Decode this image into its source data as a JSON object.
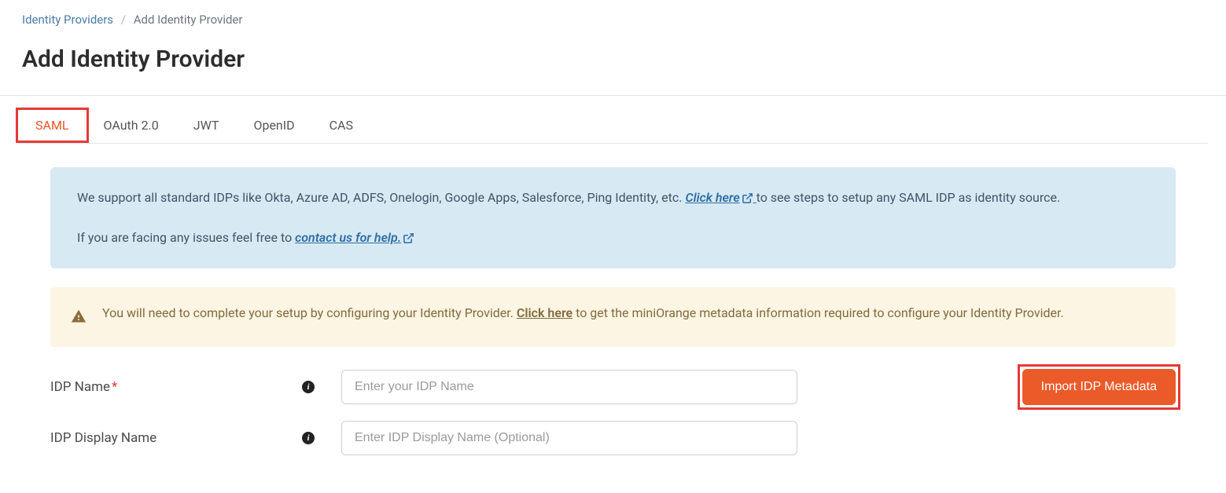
{
  "breadcrumb": {
    "parent": "Identity Providers",
    "current": "Add Identity Provider"
  },
  "page_title": "Add Identity Provider",
  "tabs": {
    "saml": "SAML",
    "oauth": "OAuth 2.0",
    "jwt": "JWT",
    "openid": "OpenID",
    "cas": "CAS"
  },
  "info_alert": {
    "text1": "We support all standard IDPs like Okta, Azure AD, ADFS, Onelogin, Google Apps, Salesforce, Ping Identity, etc. ",
    "click_here": "Click here",
    "text2": " to see steps to setup any SAML IDP as identity source.",
    "text3": "If you are facing any issues feel free to ",
    "contact_link": "contact us for help."
  },
  "warning_alert": {
    "text1": "You will need to complete your setup by configuring your Identity Provider. ",
    "click_here": "Click here",
    "text2": " to get the miniOrange metadata information required to configure your Identity Provider."
  },
  "form": {
    "idp_name_label": "IDP Name",
    "idp_name_placeholder": "Enter your IDP Name",
    "idp_display_label": "IDP Display Name",
    "idp_display_placeholder": "Enter IDP Display Name (Optional)"
  },
  "buttons": {
    "import_metadata": "Import IDP Metadata"
  },
  "icons": {
    "info": "i"
  }
}
